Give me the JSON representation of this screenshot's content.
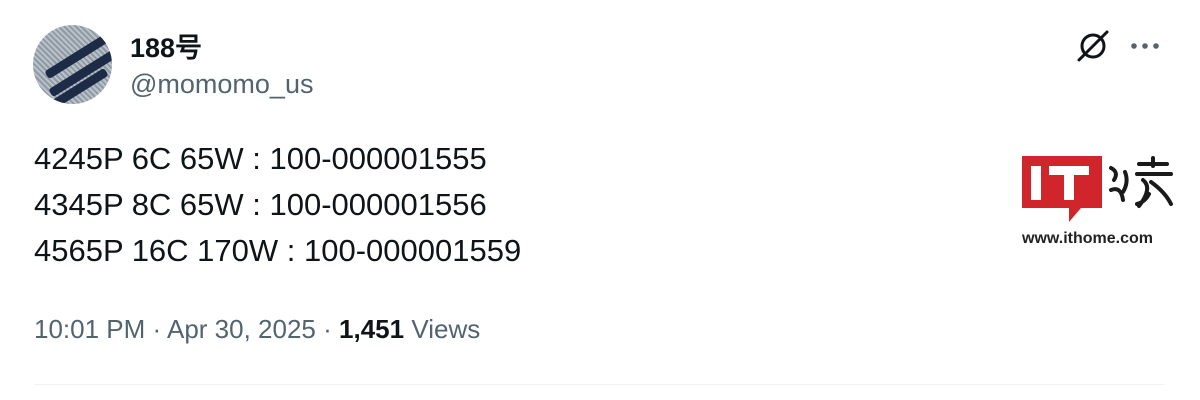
{
  "author": {
    "display_name": "188号",
    "handle": "@momomo_us"
  },
  "tweet": {
    "lines": [
      "4245P 6C 65W : 100-000001555",
      "4345P 8C 65W : 100-000001556",
      "4565P 16C 170W : 100-000001559"
    ]
  },
  "meta": {
    "time": "10:01 PM",
    "separator": "·",
    "date": "Apr 30, 2025",
    "views_count": "1,451",
    "views_label": "Views"
  },
  "watermark": {
    "logo_text": "IT之家",
    "url": "www.ithome.com",
    "color": "#d0252a"
  },
  "icons": {
    "header_right": [
      "grok-icon",
      "more-icon"
    ]
  }
}
